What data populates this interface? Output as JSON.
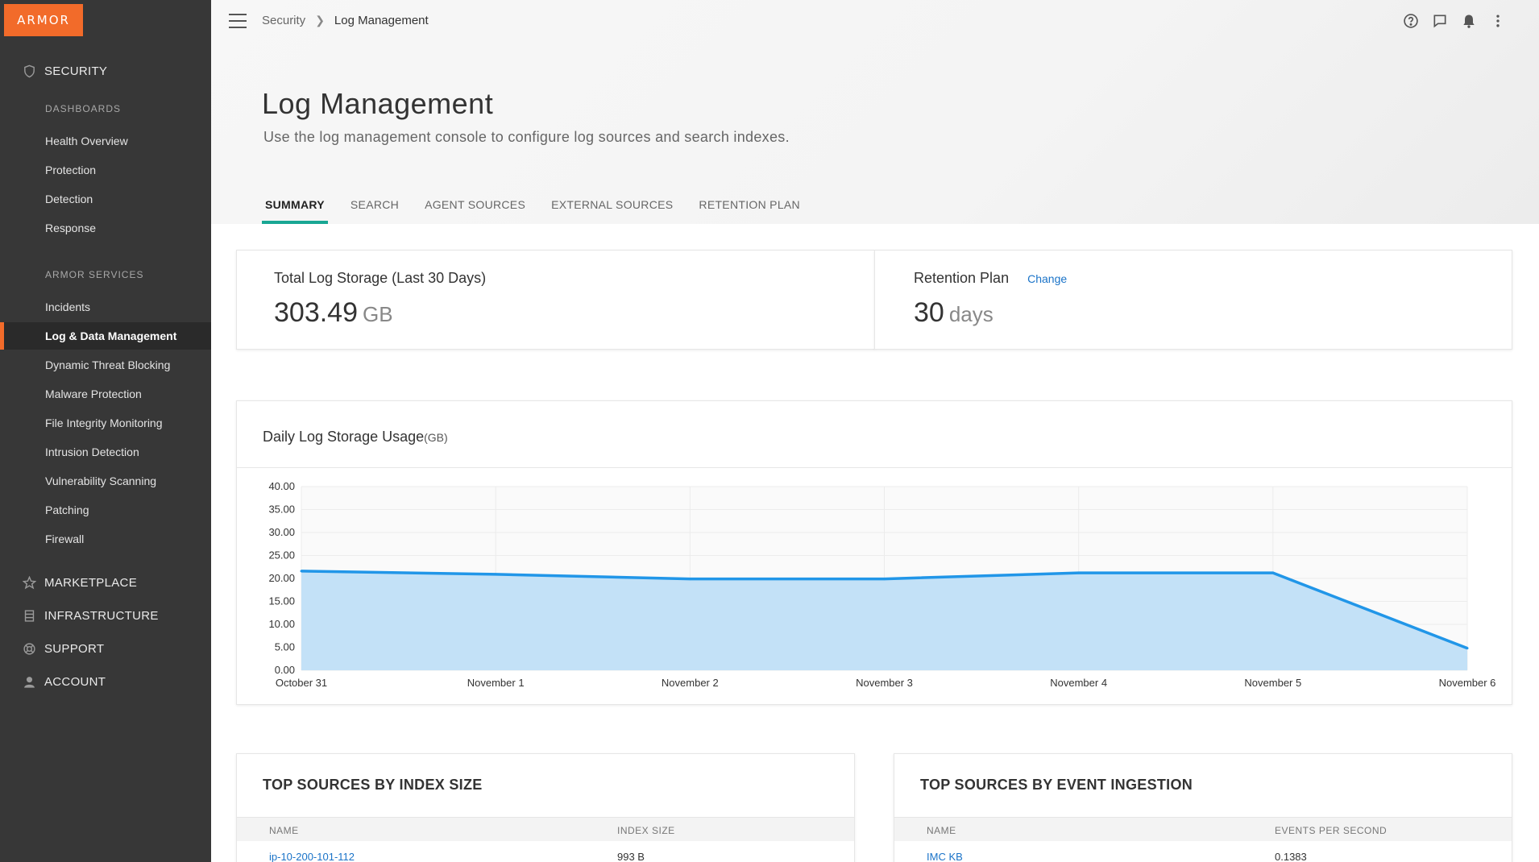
{
  "logo": "ARMOR",
  "sidebar": {
    "security": "SECURITY",
    "dashboards_heading": "DASHBOARDS",
    "dashboards": [
      "Health Overview",
      "Protection",
      "Detection",
      "Response"
    ],
    "services_heading": "ARMOR SERVICES",
    "services": [
      "Incidents",
      "Log & Data Management",
      "Dynamic Threat Blocking",
      "Malware Protection",
      "File Integrity Monitoring",
      "Intrusion Detection",
      "Vulnerability Scanning",
      "Patching",
      "Firewall"
    ],
    "active_item": "Log & Data Management",
    "marketplace": "MARKETPLACE",
    "infrastructure": "INFRASTRUCTURE",
    "support": "SUPPORT",
    "account": "ACCOUNT"
  },
  "breadcrumb": {
    "root": "Security",
    "current": "Log Management"
  },
  "page": {
    "title": "Log Management",
    "subtitle": "Use the log management console to configure log sources and search indexes."
  },
  "tabs": [
    "SUMMARY",
    "SEARCH",
    "AGENT SOURCES",
    "EXTERNAL SOURCES",
    "RETENTION PLAN"
  ],
  "active_tab": "SUMMARY",
  "storage": {
    "label": "Total Log Storage (Last 30 Days)",
    "value": "303.49",
    "unit": "GB"
  },
  "retention": {
    "label": "Retention Plan",
    "change": "Change",
    "value": "30",
    "unit": "days"
  },
  "chart_card": {
    "title": "Daily Log Storage Usage",
    "unit": "(GB)"
  },
  "chart_data": {
    "type": "area",
    "title": "Daily Log Storage Usage(GB)",
    "x": [
      "October 31",
      "November 1",
      "November 2",
      "November 3",
      "November 4",
      "November 5",
      "November 6"
    ],
    "series": [
      {
        "values": [
          21.6,
          20.9,
          19.9,
          19.9,
          21.2,
          21.2,
          4.8
        ]
      }
    ],
    "yticks": [
      "40.00",
      "35.00",
      "30.00",
      "25.00",
      "20.00",
      "15.00",
      "10.00",
      "5.00",
      "0.00"
    ],
    "ylim": [
      0,
      40
    ],
    "grid": true,
    "line_color": "#2196e8",
    "fill_color": "#c3e1f7"
  },
  "table_index": {
    "title": "TOP SOURCES BY INDEX SIZE",
    "col_name": "NAME",
    "col_value": "INDEX SIZE",
    "rows": [
      {
        "name": "ip-10-200-101-112",
        "value": "993 B"
      }
    ]
  },
  "table_events": {
    "title": "TOP SOURCES BY EVENT INGESTION",
    "col_name": "NAME",
    "col_value": "EVENTS PER SECOND",
    "rows": [
      {
        "name": "IMC KB",
        "value": "0.1383"
      }
    ]
  },
  "colors": {
    "accent": "#f26b2a",
    "tab_underline": "#19a794",
    "link": "#1a73c8",
    "sidebar": "#373737"
  }
}
